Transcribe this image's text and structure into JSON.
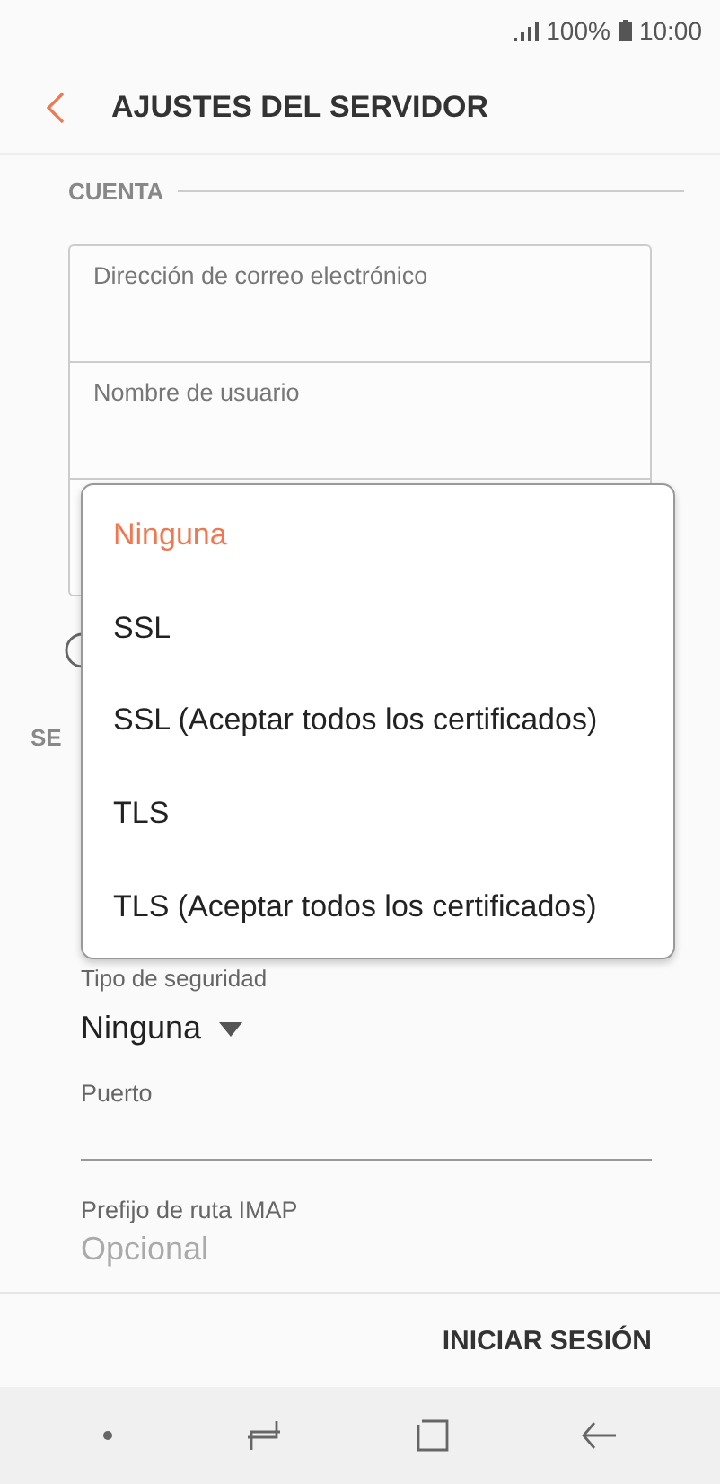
{
  "status_bar": {
    "battery": "100%",
    "time": "10:00"
  },
  "header": {
    "title": "AJUSTES DEL SERVIDOR"
  },
  "account": {
    "heading": "CUENTA",
    "fields": [
      {
        "label": "Dirección de correo electrónico"
      },
      {
        "label": "Nombre de usuario"
      }
    ]
  },
  "server": {
    "heading": "SE",
    "security": {
      "label": "Tipo de seguridad",
      "value": "Ninguna"
    },
    "port": {
      "label": "Puerto"
    },
    "imap_prefix": {
      "label": "Prefijo de ruta IMAP",
      "placeholder": "Opcional"
    }
  },
  "dropdown": {
    "options": [
      {
        "label": "Ninguna",
        "selected": true
      },
      {
        "label": "SSL",
        "selected": false
      },
      {
        "label": "SSL (Aceptar todos los certificados)",
        "selected": false
      },
      {
        "label": "TLS",
        "selected": false
      },
      {
        "label": "TLS (Aceptar todos los certificados)",
        "selected": false
      }
    ]
  },
  "footer": {
    "button": "INICIAR SESIÓN"
  }
}
